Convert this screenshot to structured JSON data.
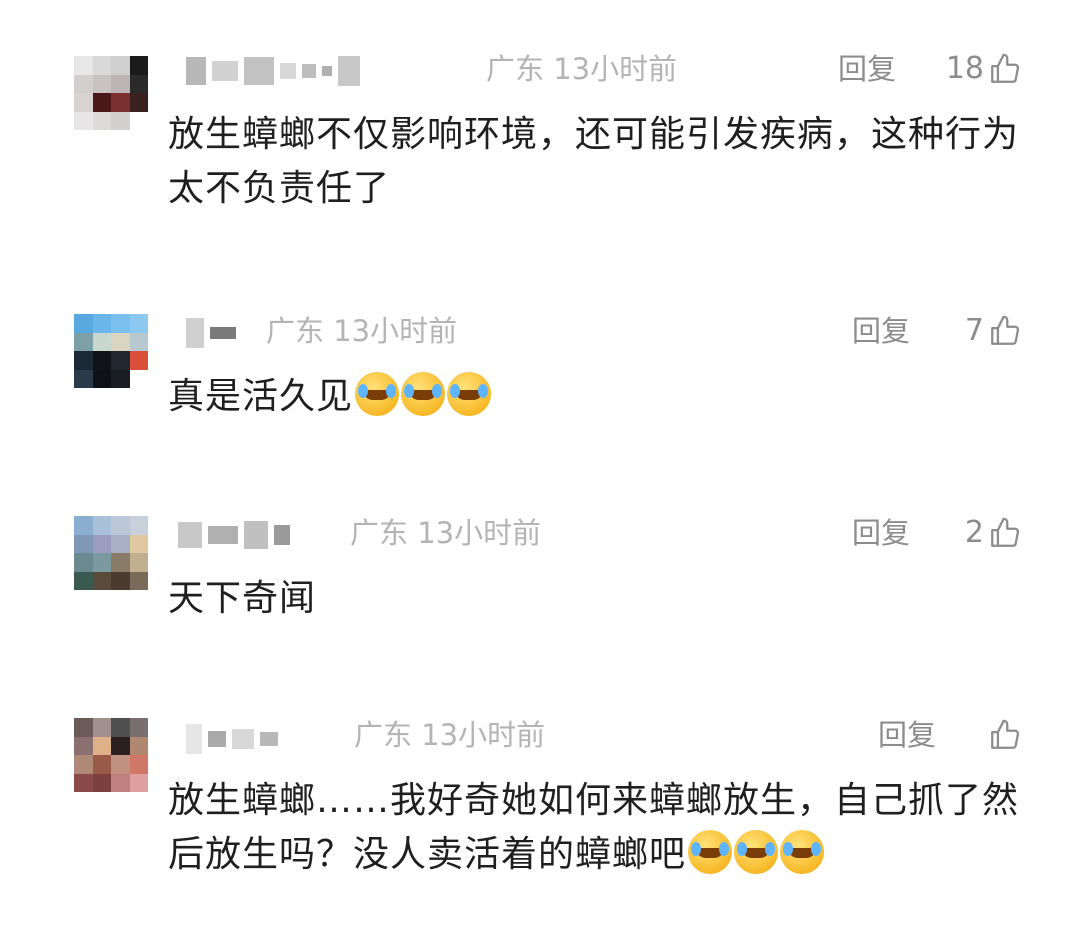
{
  "comments": [
    {
      "location": "广东",
      "time": "13小时前",
      "reply_label": "回复",
      "likes": "18",
      "text": "放生蟑螂不仅影响环境，还可能引发疾病，这种行为太不负责任了",
      "emojis": 0
    },
    {
      "location": "广东",
      "time": "13小时前",
      "reply_label": "回复",
      "likes": "7",
      "text": "真是活久见",
      "emojis": 3
    },
    {
      "location": "广东",
      "time": "13小时前",
      "reply_label": "回复",
      "likes": "2",
      "text": "天下奇闻",
      "emojis": 0
    },
    {
      "location": "广东",
      "time": "13小时前",
      "reply_label": "回复",
      "likes": "",
      "text": "放生蟑螂……我好奇她如何来蟑螂放生，自己抓了然后放生吗？没人卖活着的蟑螂吧",
      "emojis": 3
    }
  ],
  "icons": {
    "like": "thumbs-up-icon",
    "emoji": "crying-laughing-emoji-icon"
  },
  "colors": {
    "meta": "#b4b4b4",
    "reply": "#8c8c8c",
    "text": "#1f1f1f"
  }
}
